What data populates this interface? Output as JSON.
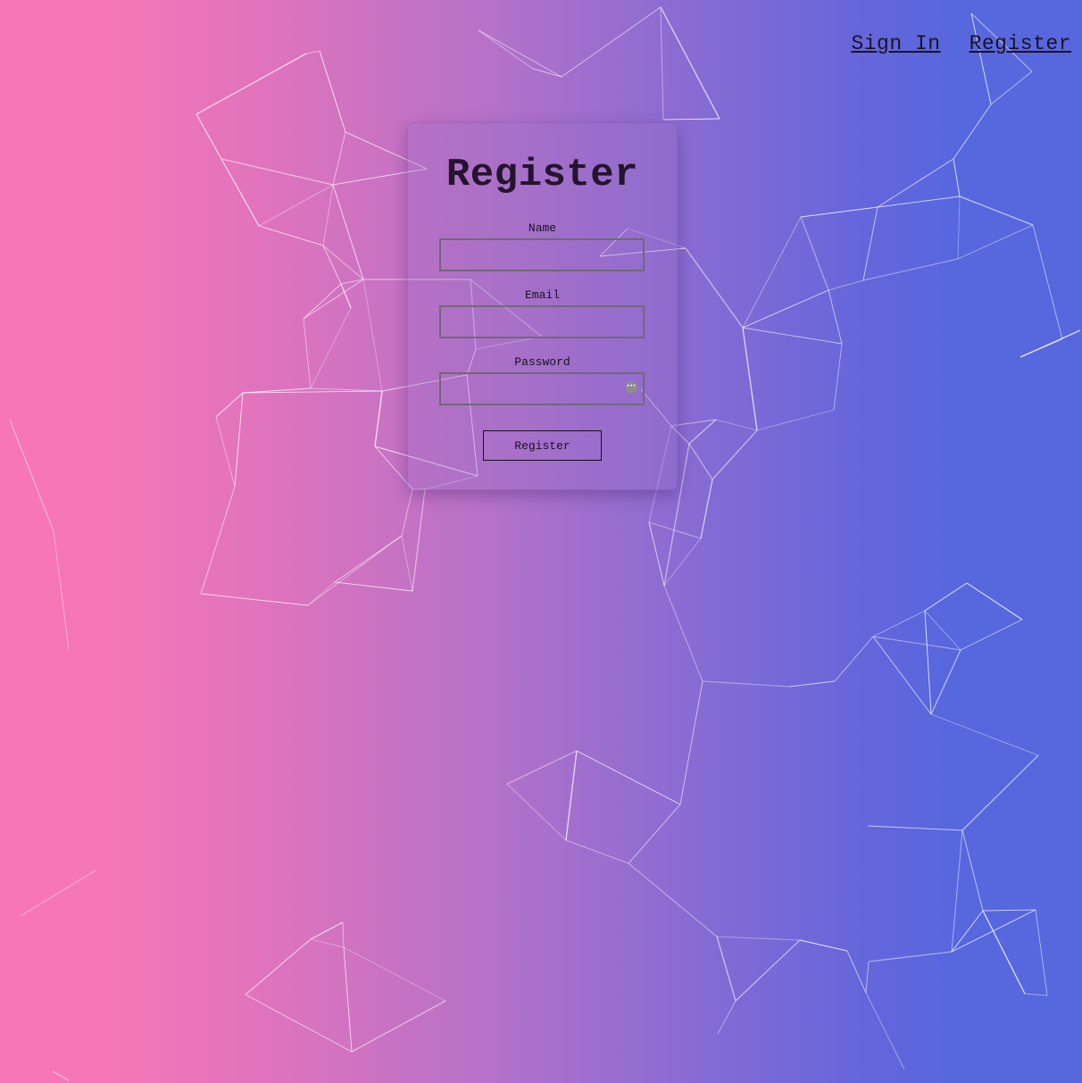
{
  "nav": {
    "sign_in": "Sign In",
    "register": "Register"
  },
  "form": {
    "title": "Register",
    "fields": [
      {
        "label": "Name",
        "value": "",
        "placeholder": ""
      },
      {
        "label": "Email",
        "value": "",
        "placeholder": ""
      },
      {
        "label": "Password",
        "value": "",
        "placeholder": ""
      }
    ],
    "submit_label": "Register"
  },
  "icons": {
    "password_manager": "password-manager-icon"
  },
  "colors": {
    "gradient_left": "#f676b7",
    "gradient_right": "#5767de",
    "text_dark": "#1a1020",
    "input_border": "#6f6a74"
  }
}
